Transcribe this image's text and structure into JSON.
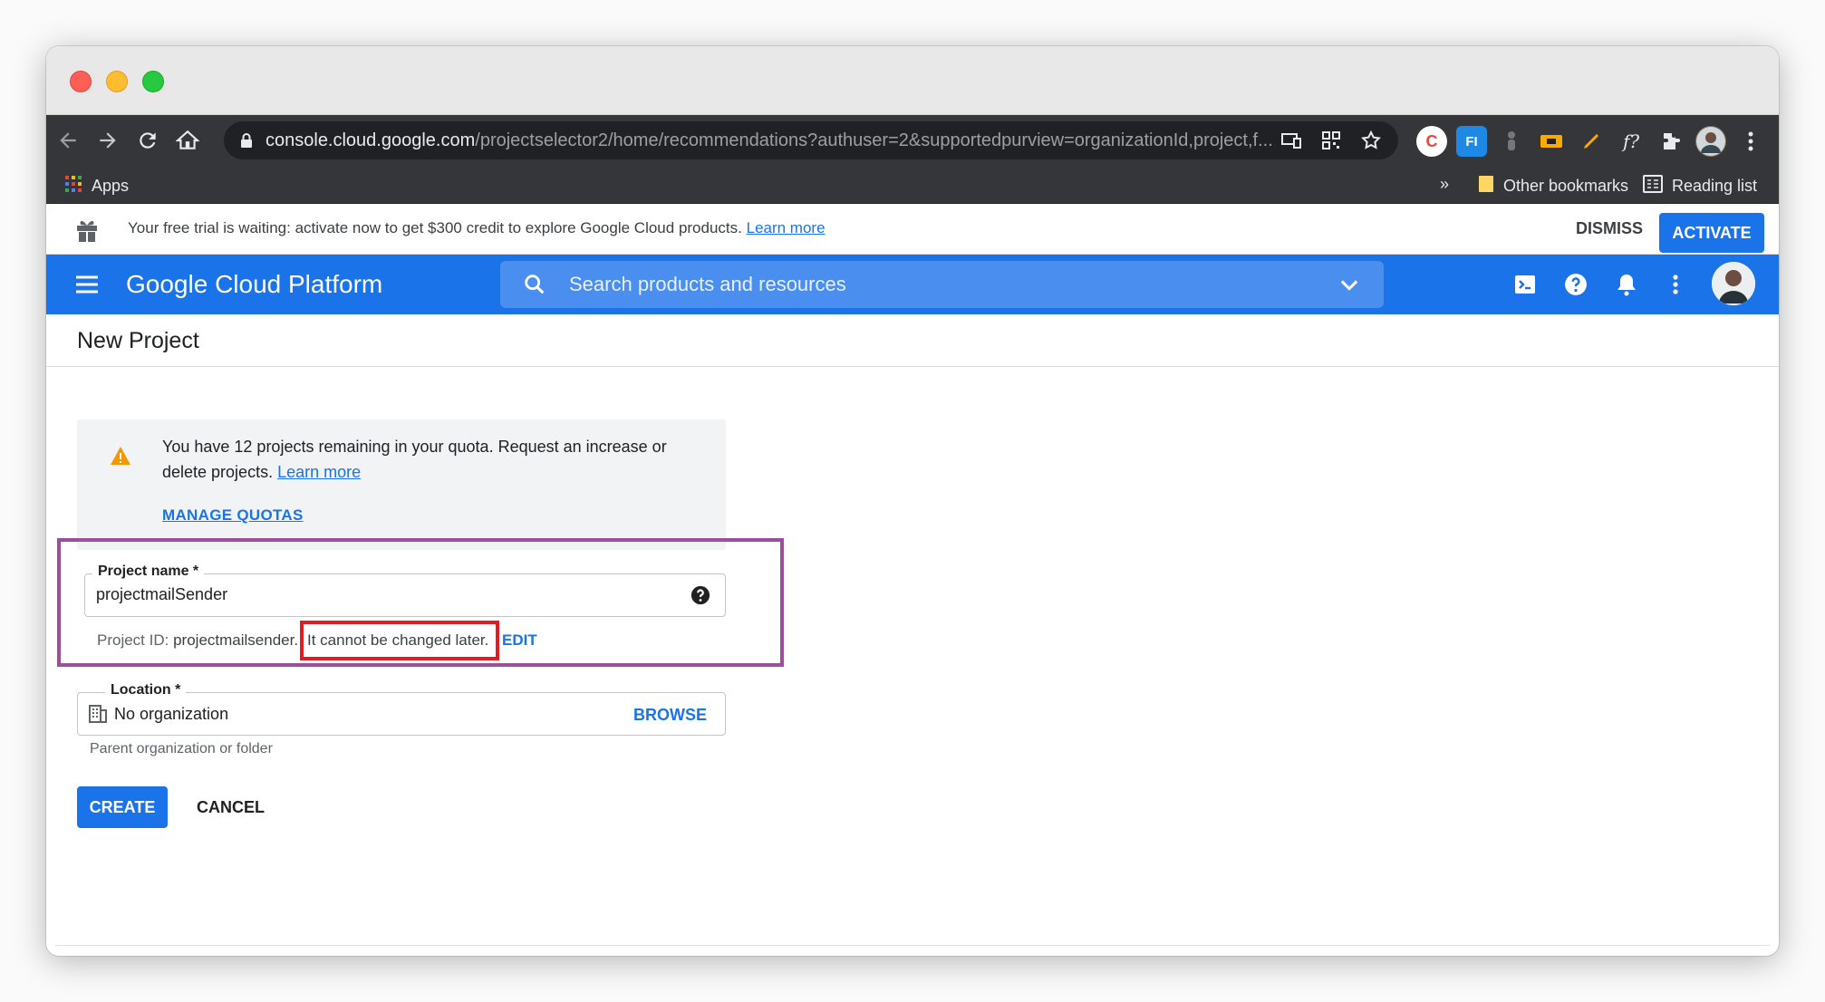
{
  "browser": {
    "url_host": "console.cloud.google.com",
    "url_path": "/projectselector2/home/recommendations?authuser=2&supportedpurview=organizationId,project,f...",
    "bookmarks": {
      "apps_label": "Apps",
      "overflow_label": "»",
      "other_label": "Other bookmarks",
      "reading_label": "Reading list"
    },
    "extensions": {
      "c_label": "C",
      "fi_label": "FI",
      "f_label": "f?"
    }
  },
  "banner": {
    "text": "Your free trial is waiting: activate now to get $300 credit to explore Google Cloud products.",
    "link": "Learn more",
    "dismiss": "DISMISS",
    "activate": "ACTIVATE"
  },
  "header": {
    "title": "Google Cloud Platform",
    "search_placeholder": "Search products and resources"
  },
  "page": {
    "title": "New Project"
  },
  "quota": {
    "text": "You have 12 projects remaining in your quota. Request an increase or delete projects.",
    "link": "Learn more",
    "manage": "MANAGE QUOTAS"
  },
  "form": {
    "project_name_label": "Project name *",
    "project_name_value": "projectmailSender",
    "project_id_prefix": "Project ID:",
    "project_id_value": "projectmailsender.",
    "project_id_note": "It cannot be changed later.",
    "edit": "EDIT",
    "location_label": "Location *",
    "location_value": "No organization",
    "browse": "BROWSE",
    "location_helper": "Parent organization or folder",
    "create": "CREATE",
    "cancel": "CANCEL"
  },
  "colors": {
    "brand_blue": "#1a73e8",
    "highlight_purple": "#9c4d9c",
    "highlight_red": "#e31c23",
    "warning_orange": "#f29900"
  }
}
